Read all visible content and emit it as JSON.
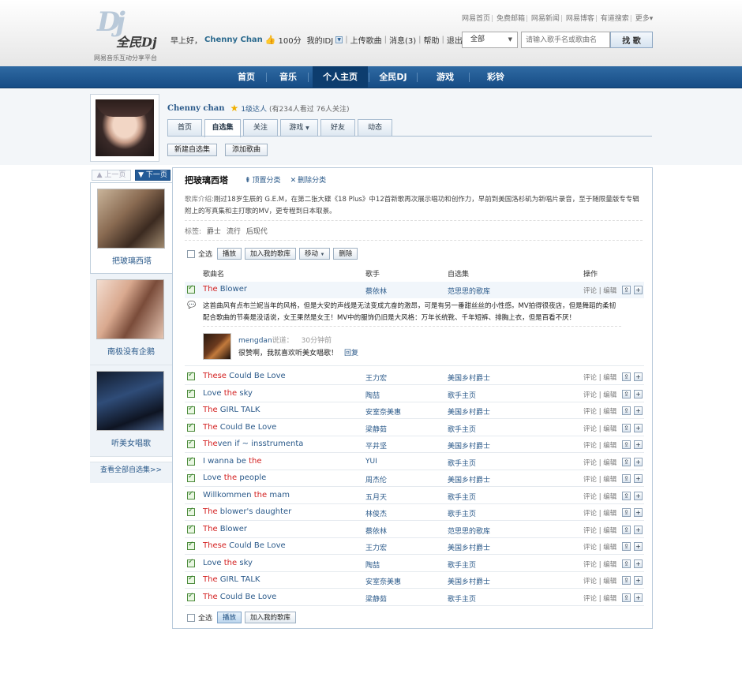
{
  "header": {
    "logo_mark": "Dj",
    "logo_name": "全民Dj",
    "logo_slogan": "网易音乐互动分享平台",
    "greeting": "早上好，",
    "username": "Chenny Chan",
    "score": "100分",
    "my_idj": "我的IDJ",
    "upload": "上传歌曲",
    "messages": "消息(3)",
    "help": "帮助",
    "logout": "退出"
  },
  "toplinks": [
    "网易首页",
    "免费邮箱",
    "网易新闻",
    "网易博客",
    "有道搜索",
    "更多▾"
  ],
  "search": {
    "category": "全部",
    "placeholder": "请输入歌手名或歌曲名",
    "button": "找 歌"
  },
  "nav": [
    "首页",
    "音乐",
    "个人主页",
    "全民DJ",
    "游戏",
    "彩铃"
  ],
  "profile": {
    "name": "Chenny chan",
    "level": "1级达人",
    "stats": "(有234人看过 76人关注)",
    "tabs": [
      "首页",
      "自选集",
      "关注",
      "游戏",
      "好友",
      "动态"
    ],
    "new_set_button": "新建自选集",
    "add_song_button": "添加歌曲"
  },
  "sidebar": {
    "prev": "上一页",
    "next": "下一页",
    "albums": [
      "把玻璃西塔",
      "南极没有企鹅",
      "听美女唱歌"
    ],
    "all_sets": "查看全部自选集>>"
  },
  "set": {
    "title": "把玻璃西塔",
    "pin": "顶置分类",
    "delete": "删除分类",
    "desc_label": "歌库介绍:",
    "desc": "刚过18岁生辰的 G.E.M，在第二张大碟《18 Plus》中12首新歌再次展示唱功和创作力，早前到美国洛杉矶为新唱片录音，至于随限量版专专辑附上的写真集和主打歌的MV，更专程到日本取景。",
    "tags_label": "标签:",
    "tags": [
      "爵士",
      "流行",
      "后现代"
    ]
  },
  "toolbar": {
    "select_all": "全选",
    "play": "播放",
    "add_to_library": "加入我的歌库",
    "move": "移动",
    "delete": "删除"
  },
  "table": {
    "headers": [
      "歌曲名",
      "歌手",
      "自选集",
      "操作"
    ],
    "op_comment": "评论",
    "op_edit": "编辑",
    "rows": [
      {
        "pre": "",
        "red": "The",
        "post": " Blower",
        "singer": "蔡依林",
        "set": "范思思的歌库"
      },
      {
        "pre": "",
        "red": "These",
        "post": " Could Be Love",
        "singer": "王力宏",
        "set": "美国乡村爵士"
      },
      {
        "pre": "Love ",
        "red": "the",
        "post": " sky",
        "singer": "陶喆",
        "set": "歌手主页"
      },
      {
        "pre": "",
        "red": "The",
        "post": " GIRL TALK",
        "singer": "安室奈美惠",
        "set": "美国乡村爵士"
      },
      {
        "pre": "",
        "red": "The",
        "post": " Could Be Love",
        "singer": "梁静茹",
        "set": "歌手主页"
      },
      {
        "pre": "",
        "red": "The",
        "post": "ven if ~ insstrumenta",
        "singer": "平井坚",
        "set": "美国乡村爵士"
      },
      {
        "pre": "I wanna be ",
        "red": "the",
        "post": "",
        "singer": "YUI",
        "set": "歌手主页"
      },
      {
        "pre": "Love ",
        "red": "the",
        "post": " people",
        "singer": "周杰伦",
        "set": "美国乡村爵士"
      },
      {
        "pre": "Willkommen ",
        "red": "the",
        "post": " mam",
        "singer": "五月天",
        "set": "歌手主页"
      },
      {
        "pre": "",
        "red": "The",
        "post": " blower's daughter",
        "singer": "林俊杰",
        "set": "歌手主页"
      },
      {
        "pre": "",
        "red": "The",
        "post": " Blower",
        "singer": "蔡依林",
        "set": "范思思的歌库"
      },
      {
        "pre": "",
        "red": "These",
        "post": " Could Be Love",
        "singer": "王力宏",
        "set": "美国乡村爵士"
      },
      {
        "pre": "Love ",
        "red": "the",
        "post": " sky",
        "singer": "陶喆",
        "set": "歌手主页"
      },
      {
        "pre": "",
        "red": "The",
        "post": " GIRL TALK",
        "singer": "安室奈美惠",
        "set": "美国乡村爵士"
      },
      {
        "pre": "",
        "red": "The",
        "post": " Could Be Love",
        "singer": "梁静茹",
        "set": "歌手主页"
      }
    ]
  },
  "comment": {
    "text": "这首曲风有点布兰妮当年的风格，但是大安的声线是无法变成亢奋的激昂，可是有另一番甜丝丝的小性感。MV拍得很夜店，但是舞蹈的柔韧配合歌曲的节奏是没话说，女王果然是女王！MV中的服饰仍旧是大风格：万年长统靴、千年短裤、排胸上衣，但是百看不厌！",
    "reply_user": "mengdan",
    "reply_said": "说道：",
    "reply_time": "30分钟前",
    "reply_text": "很赞啊，我就喜欢听美女唱歌！",
    "reply_link": "回复"
  },
  "colors": {
    "nav": "#1f5a94",
    "link": "#2b5a8a",
    "highlight": "#d32020"
  },
  "icons": {
    "share": "share-icon",
    "add": "plus-icon",
    "comment": "comment-icon",
    "pin": "pin-icon",
    "delete": "x-icon"
  }
}
